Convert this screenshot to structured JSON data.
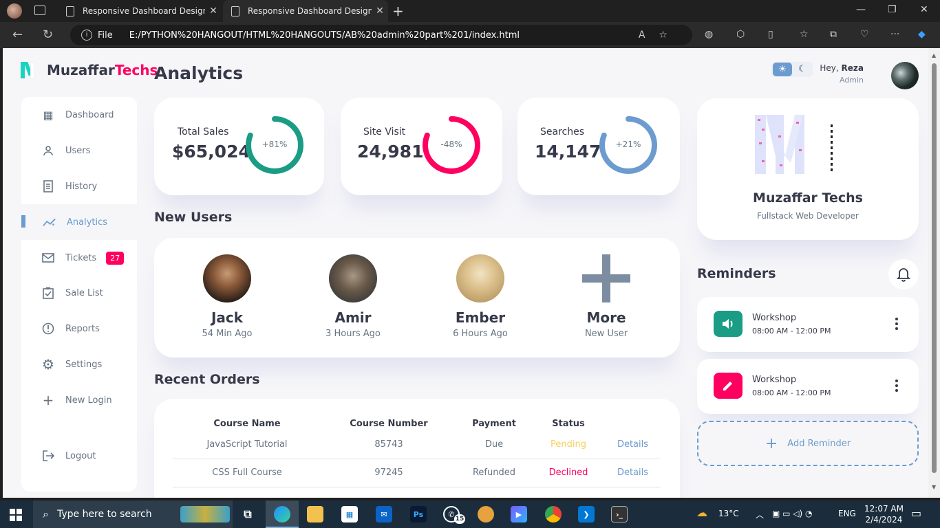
{
  "browser": {
    "tabs": [
      {
        "title": "Responsive Dashboard Design #"
      },
      {
        "title": "Responsive Dashboard Design #"
      }
    ],
    "address": {
      "scheme_label": "File",
      "url": "E:/PYTHON%20HANGOUT/HTML%20HANGOUTS/AB%20admin%20part%201/index.html"
    }
  },
  "colors": {
    "primary": "#6c9bcf",
    "danger": "#ff0060",
    "success": "#1b9c85",
    "warning": "#f7d060",
    "dark": "#363949"
  },
  "logo": {
    "brand": "Muzaffar",
    "accent": "Techs"
  },
  "page_title": "Analytics",
  "sidebar": {
    "items": [
      {
        "label": "Dashboard",
        "icon": "grid-icon"
      },
      {
        "label": "Users",
        "icon": "person-icon"
      },
      {
        "label": "History",
        "icon": "receipt-icon"
      },
      {
        "label": "Analytics",
        "icon": "insights-icon",
        "active": true
      },
      {
        "label": "Tickets",
        "icon": "mail-icon",
        "badge": "27"
      },
      {
        "label": "Sale List",
        "icon": "clipboard-icon"
      },
      {
        "label": "Reports",
        "icon": "report-icon"
      },
      {
        "label": "Settings",
        "icon": "gear-icon"
      },
      {
        "label": "New Login",
        "icon": "plus-icon"
      },
      {
        "label": "Logout",
        "icon": "logout-icon"
      }
    ]
  },
  "stats": [
    {
      "label": "Total Sales",
      "value": "$65,024",
      "percent": "+81%",
      "ring_fraction": 0.81,
      "color": "#1b9c85"
    },
    {
      "label": "Site Visit",
      "value": "24,981",
      "percent": "-48%",
      "ring_fraction": 0.81,
      "color": "#ff0060"
    },
    {
      "label": "Searches",
      "value": "14,147",
      "percent": "+21%",
      "ring_fraction": 0.81,
      "color": "#6c9bcf"
    }
  ],
  "new_users": {
    "title": "New Users",
    "users": [
      {
        "name": "Jack",
        "time": "54 Min Ago"
      },
      {
        "name": "Amir",
        "time": "3 Hours Ago"
      },
      {
        "name": "Ember",
        "time": "6 Hours Ago"
      },
      {
        "name": "More",
        "time": "New User"
      }
    ]
  },
  "recent_orders": {
    "title": "Recent Orders",
    "headers": [
      "Course Name",
      "Course Number",
      "Payment",
      "Status",
      ""
    ],
    "rows": [
      {
        "course": "JavaScript Tutorial",
        "number": "85743",
        "payment": "Due",
        "status": "Pending",
        "action": "Details"
      },
      {
        "course": "CSS Full Course",
        "number": "97245",
        "payment": "Refunded",
        "status": "Declined",
        "action": "Details"
      }
    ]
  },
  "header": {
    "greeting": "Hey,",
    "user": "Reza",
    "role": "Admin"
  },
  "profile": {
    "name": "Muzaffar Techs",
    "role": "Fullstack Web Developer"
  },
  "reminders": {
    "title": "Reminders",
    "items": [
      {
        "title": "Workshop",
        "time": "08:00 AM - 12:00 PM",
        "icon": "volume-icon",
        "color": "#1b9c85"
      },
      {
        "title": "Workshop",
        "time": "08:00 AM - 12:00 PM",
        "icon": "edit-icon",
        "color": "#ff0060"
      }
    ],
    "add_label": "Add Reminder"
  },
  "taskbar": {
    "search_placeholder": "Type here to search",
    "whatsapp_badge": "15",
    "weather": "13°C",
    "lang": "ENG",
    "time": "12:07 AM",
    "date": "2/4/2024"
  }
}
